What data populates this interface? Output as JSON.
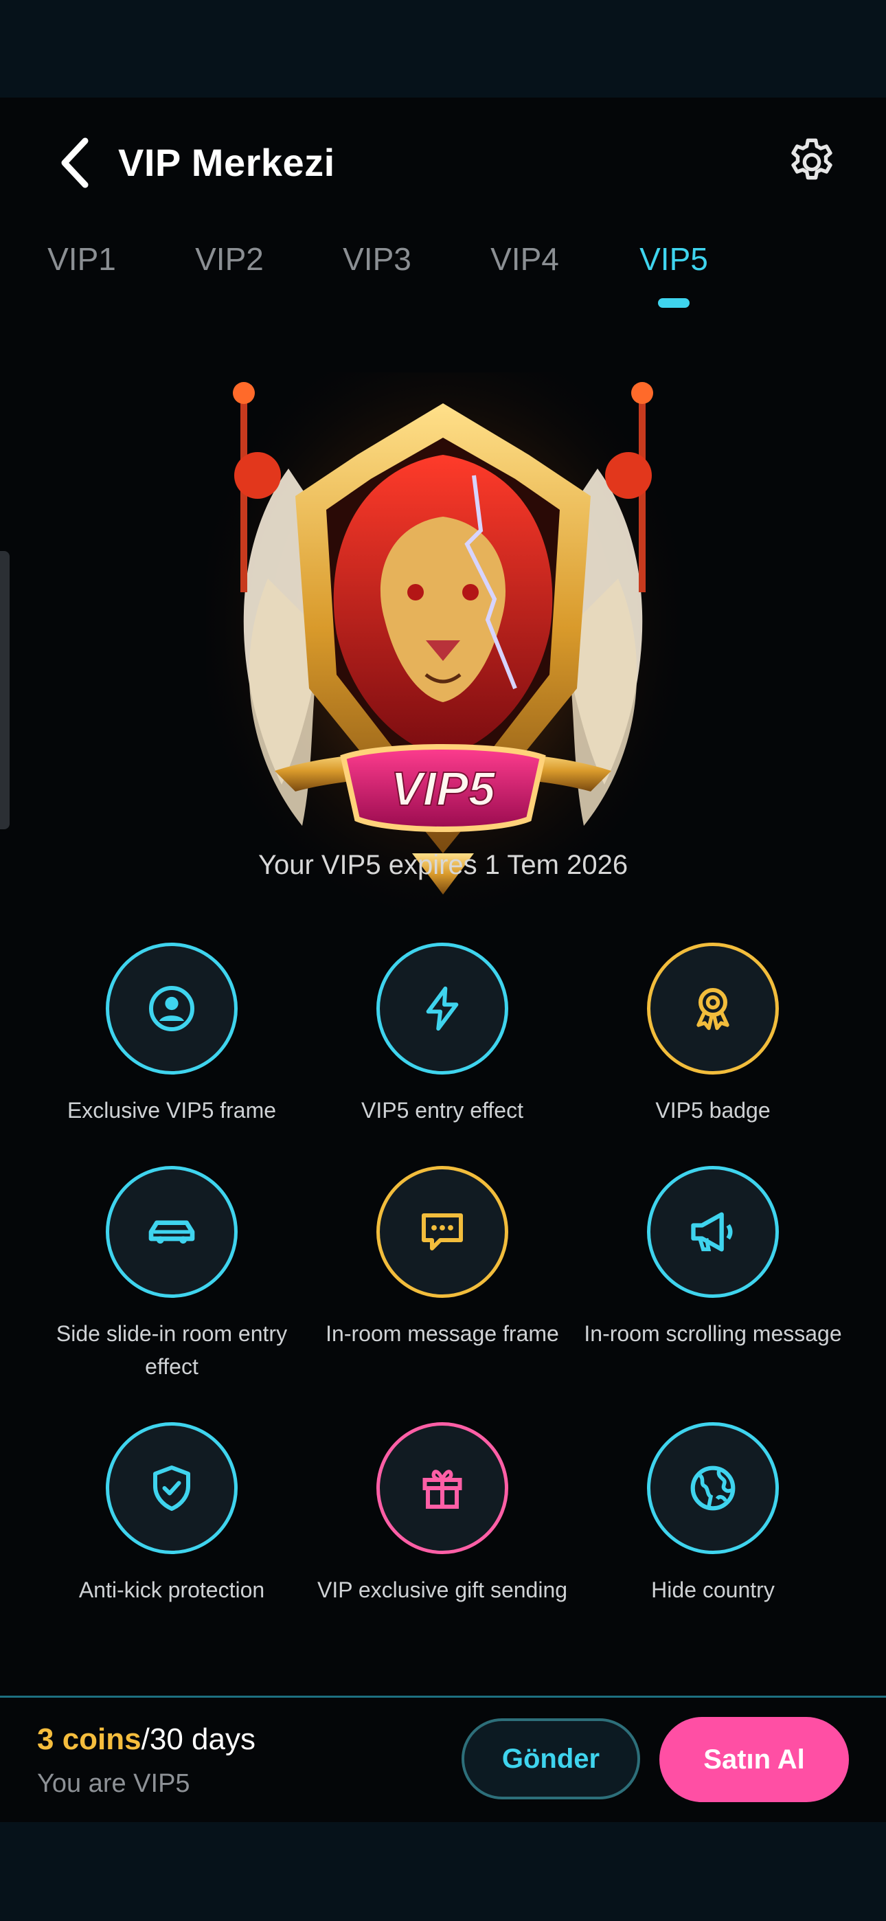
{
  "header": {
    "title": "VIP Merkezi",
    "back_icon": "chevron-left-icon",
    "settings_icon": "gear-icon"
  },
  "tabs": [
    {
      "label": "VIP1",
      "active": false
    },
    {
      "label": "VIP2",
      "active": false
    },
    {
      "label": "VIP3",
      "active": false
    },
    {
      "label": "VIP4",
      "active": false
    },
    {
      "label": "VIP5",
      "active": true
    }
  ],
  "hero": {
    "badge_text": "VIP5",
    "expiry": "Your VIP5 expires 1 Tem 2026"
  },
  "features": [
    {
      "label": "Exclusive VIP5 frame",
      "icon": "user-frame-icon",
      "color": "#3fd4ee"
    },
    {
      "label": "VIP5 entry effect",
      "icon": "lightning-icon",
      "color": "#3fd4ee"
    },
    {
      "label": "VIP5 badge",
      "icon": "award-ribbon-icon",
      "color": "#f2bd3c"
    },
    {
      "label": "Side slide-in room entry effect",
      "icon": "car-icon",
      "color": "#3fd4ee"
    },
    {
      "label": "In-room message frame",
      "icon": "chat-bubble-icon",
      "color": "#f2bd3c"
    },
    {
      "label": "In-room scrolling message",
      "icon": "megaphone-icon",
      "color": "#3fd4ee"
    },
    {
      "label": "Anti-kick protection",
      "icon": "shield-check-icon",
      "color": "#3fd4ee"
    },
    {
      "label": "VIP exclusive gift sending",
      "icon": "gift-icon",
      "color": "#ff5fa6"
    },
    {
      "label": "Hide country",
      "icon": "globe-icon",
      "color": "#3fd4ee"
    }
  ],
  "bottom": {
    "coins": "3 coins",
    "period": "/30 days",
    "status": "You are VIP5",
    "send_label": "Gönder",
    "buy_label": "Satın Al"
  },
  "colors": {
    "accent": "#3fd4ee",
    "gold": "#f2bd3c",
    "pink": "#ff4fa4",
    "background": "#040608"
  }
}
